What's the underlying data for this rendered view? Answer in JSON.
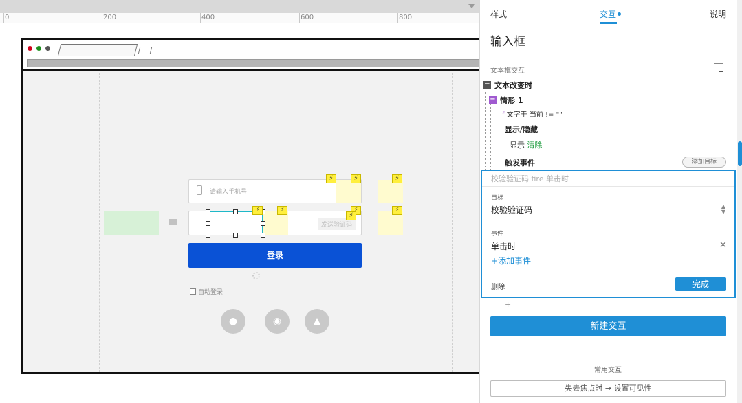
{
  "ruler": {
    "labels": [
      "0",
      "200",
      "400",
      "600",
      "800"
    ]
  },
  "canvas": {
    "phone_placeholder": "请输入手机号",
    "get_code_label": "发送验证码",
    "login_button": "登录",
    "auto_login_label": "自动登录",
    "lightning_glyph": "⚡"
  },
  "panel": {
    "tabs": {
      "style": "样式",
      "interaction": "交互",
      "notes": "说明"
    },
    "widget_name": "输入框",
    "section_title": "文本框交互",
    "event_name": "文本改变时",
    "case_name": "情形 1",
    "condition_keyword": "If",
    "condition_text": "文字于 当前 != \"\"",
    "action1_name": "显示/隐藏",
    "action1_verb": "显示",
    "action1_target": "清除",
    "action2_name": "触发事件",
    "add_target_label": "添加目标",
    "fire_summary": "校验验证码 fire 单击时",
    "target_label": "目标",
    "target_value": "校验验证码",
    "event_label": "事件",
    "event_value": "单击时",
    "add_event_label": "+添加事件",
    "delete_label": "删除",
    "done_label": "完成",
    "plus_label": "+",
    "new_interaction_label": "新建交互",
    "common_label": "常用交互",
    "common_item": "失去焦点时 → 设置可见性"
  },
  "colors": {
    "accent": "#1f8fd6",
    "login_blue": "#0a52d6",
    "lightning_yellow": "#ffef3d",
    "target_green": "#1a9a3a"
  }
}
